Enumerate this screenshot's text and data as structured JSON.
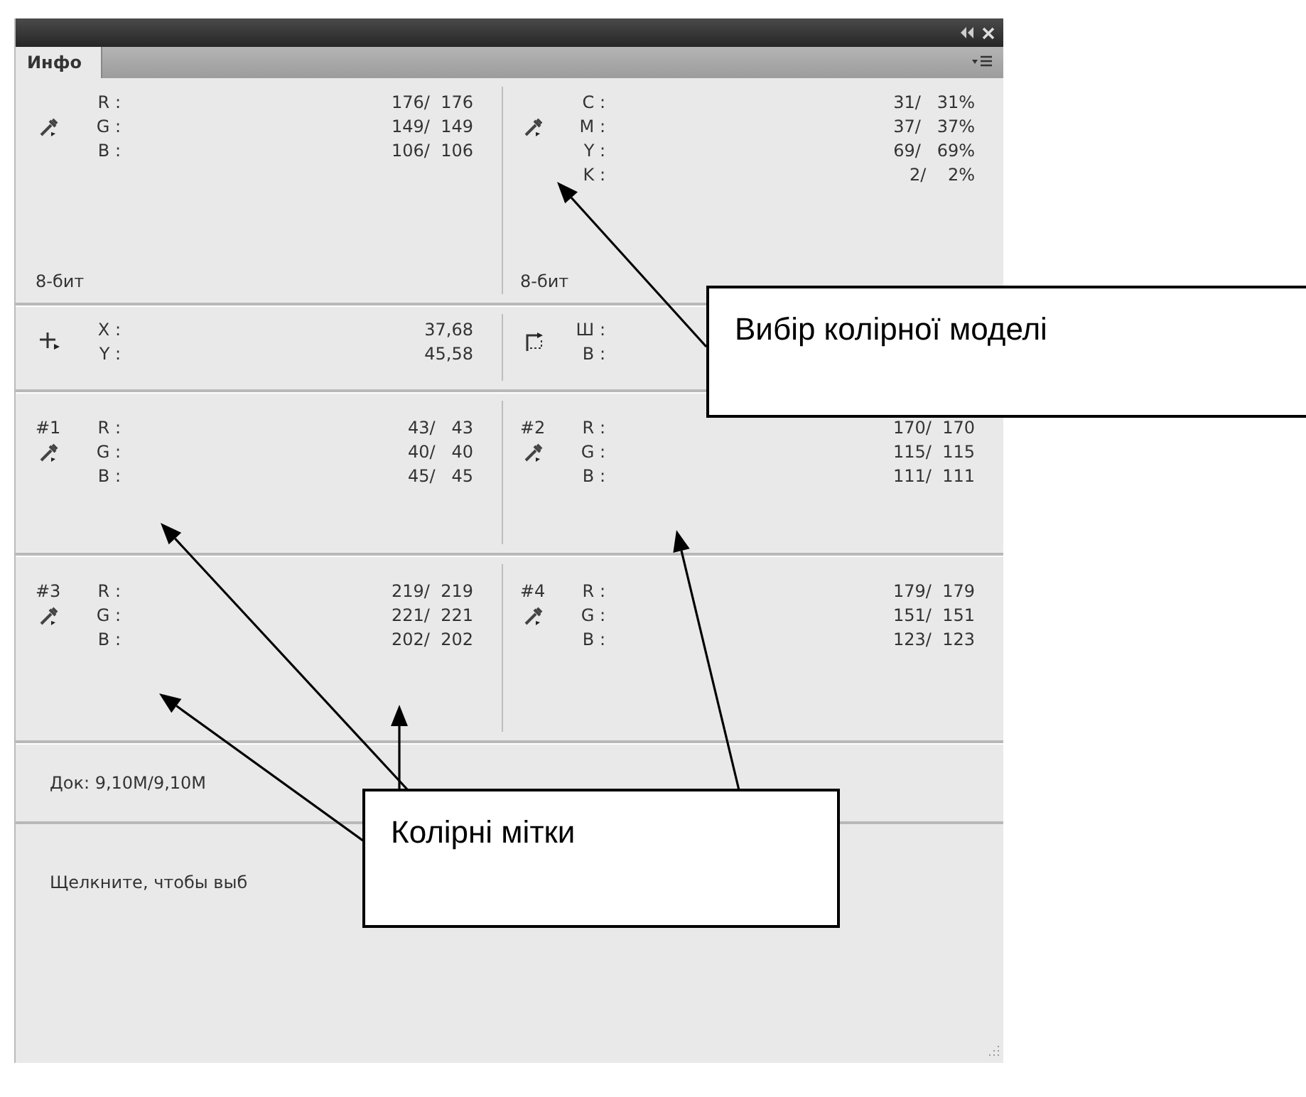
{
  "panel": {
    "tab": {
      "label": "Инфо",
      "selected": true
    },
    "readouts": [
      {
        "cells": [
          {
            "kind": "eyedropper",
            "fields": [
              {
                "label": "R :",
                "value": "176/  176"
              },
              {
                "label": "G :",
                "value": "149/  149"
              },
              {
                "label": "B :",
                "value": "106/  106"
              }
            ],
            "bit_depth": "8-бит"
          },
          {
            "kind": "eyedropper",
            "fields": [
              {
                "label": "C :",
                "value": "31/   31%"
              },
              {
                "label": "M :",
                "value": "37/   37%"
              },
              {
                "label": "Y :",
                "value": "69/   69%"
              },
              {
                "label": "K :",
                "value": "2/    2%"
              }
            ],
            "bit_depth": "8-бит"
          }
        ]
      },
      {
        "cells": [
          {
            "kind": "crosshair",
            "fields": [
              {
                "label": "X :",
                "value": "37,68"
              },
              {
                "label": "Y :",
                "value": "45,58"
              }
            ]
          },
          {
            "kind": "marquee",
            "fields": [
              {
                "label": "Ш :"
              },
              {
                "label": "B :"
              }
            ]
          }
        ]
      },
      {
        "cells": [
          {
            "marker": "#1",
            "kind": "eyedropper",
            "fields": [
              {
                "label": "R :",
                "value": "43/   43"
              },
              {
                "label": "G :",
                "value": "40/   40"
              },
              {
                "label": "B :",
                "value": "45/   45"
              }
            ]
          },
          {
            "marker": "#2",
            "kind": "eyedropper",
            "fields": [
              {
                "label": "R :",
                "value": "170/  170"
              },
              {
                "label": "G :",
                "value": "115/  115"
              },
              {
                "label": "B :",
                "value": "111/  111"
              }
            ]
          }
        ]
      },
      {
        "cells": [
          {
            "marker": "#3",
            "kind": "eyedropper",
            "fields": [
              {
                "label": "R :",
                "value": "219/  219"
              },
              {
                "label": "G :",
                "value": "221/  221"
              },
              {
                "label": "B :",
                "value": "202/  202"
              }
            ]
          },
          {
            "marker": "#4",
            "kind": "eyedropper",
            "fields": [
              {
                "label": "R :",
                "value": "179/  179"
              },
              {
                "label": "G :",
                "value": "151/  151"
              },
              {
                "label": "B :",
                "value": "123/  123"
              }
            ]
          }
        ]
      }
    ],
    "document_size": "Док: 9,10M/9,10M",
    "hint": "Щелкните, чтобы выб"
  },
  "callouts": [
    {
      "text": "Вибір колірної моделі"
    },
    {
      "text": "Колірні мітки"
    }
  ]
}
